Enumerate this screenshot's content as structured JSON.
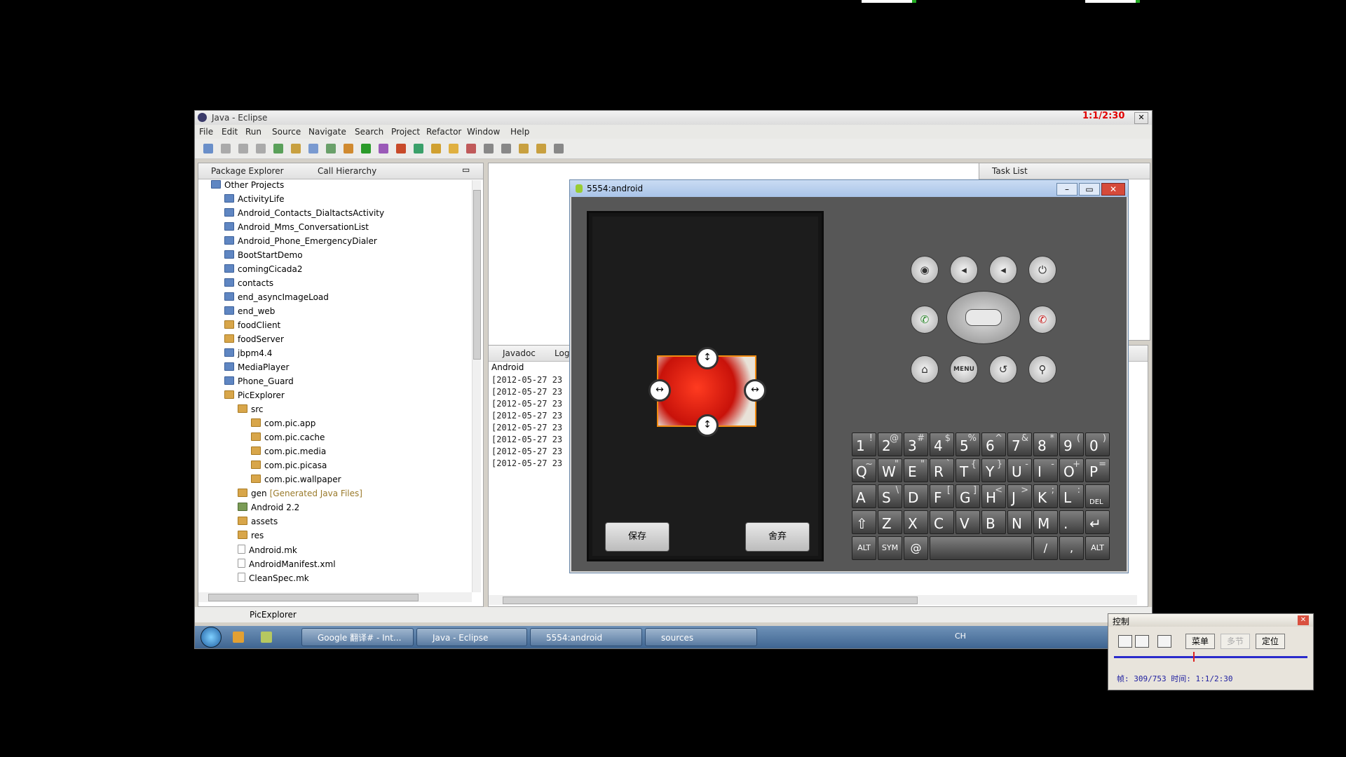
{
  "desktop": {
    "recording_overlay": "1:1/2:30"
  },
  "eclipse": {
    "title": "Java - Eclipse",
    "menu": [
      "File",
      "Edit",
      "Run",
      "Source",
      "Navigate",
      "Search",
      "Project",
      "Refactor",
      "Window",
      "Help"
    ],
    "views": {
      "package_explorer": "Package Explorer",
      "call_hierarchy": "Call Hierarchy",
      "task_list": "Task List",
      "javadoc": "Javadoc",
      "log": "Log"
    },
    "tree": [
      {
        "label": "Other Projects",
        "indent": 0,
        "icon": "folder"
      },
      {
        "label": "ActivityLife",
        "indent": 1,
        "icon": "folder"
      },
      {
        "label": "Android_Contacts_DialtactsActivity",
        "indent": 1,
        "icon": "folder"
      },
      {
        "label": "Android_Mms_ConversationList",
        "indent": 1,
        "icon": "folder"
      },
      {
        "label": "Android_Phone_EmergencyDialer",
        "indent": 1,
        "icon": "folder"
      },
      {
        "label": "BootStartDemo",
        "indent": 1,
        "icon": "folder"
      },
      {
        "label": "comingCicada2",
        "indent": 1,
        "icon": "folder"
      },
      {
        "label": "contacts",
        "indent": 1,
        "icon": "folder"
      },
      {
        "label": "end_asyncImageLoad",
        "indent": 1,
        "icon": "folder"
      },
      {
        "label": "end_web",
        "indent": 1,
        "icon": "folder"
      },
      {
        "label": "foodClient",
        "indent": 1,
        "icon": "pkg"
      },
      {
        "label": "foodServer",
        "indent": 1,
        "icon": "pkg"
      },
      {
        "label": "jbpm4.4",
        "indent": 1,
        "icon": "folder"
      },
      {
        "label": "MediaPlayer",
        "indent": 1,
        "icon": "folder"
      },
      {
        "label": "Phone_Guard",
        "indent": 1,
        "icon": "folder"
      },
      {
        "label": "PicExplorer",
        "indent": 1,
        "icon": "pkg"
      },
      {
        "label": "src",
        "indent": 2,
        "icon": "pkg"
      },
      {
        "label": "com.pic.app",
        "indent": 3,
        "icon": "pkg"
      },
      {
        "label": "com.pic.cache",
        "indent": 3,
        "icon": "pkg"
      },
      {
        "label": "com.pic.media",
        "indent": 3,
        "icon": "pkg"
      },
      {
        "label": "com.pic.picasa",
        "indent": 3,
        "icon": "pkg"
      },
      {
        "label": "com.pic.wallpaper",
        "indent": 3,
        "icon": "pkg"
      },
      {
        "label": "gen",
        "suffix": "[Generated Java Files]",
        "indent": 2,
        "icon": "pkg"
      },
      {
        "label": "Android 2.2",
        "indent": 2,
        "icon": "lib"
      },
      {
        "label": "assets",
        "indent": 2,
        "icon": "pkg"
      },
      {
        "label": "res",
        "indent": 2,
        "icon": "pkg"
      },
      {
        "label": "Android.mk",
        "indent": 2,
        "icon": "file"
      },
      {
        "label": "AndroidManifest.xml",
        "indent": 2,
        "icon": "file"
      },
      {
        "label": "CleanSpec.mk",
        "indent": 2,
        "icon": "file"
      }
    ],
    "console": {
      "header": "Android",
      "lines": [
        "[2012-05-27 23",
        "[2012-05-27 23",
        "[2012-05-27 23",
        "[2012-05-27 23",
        "[2012-05-27 23",
        "[2012-05-27 23",
        "[2012-05-27 23",
        "[2012-05-27 23"
      ]
    },
    "status": "PicExplorer"
  },
  "taskbar": {
    "buttons": [
      "Google 翻译# - Int...",
      "Java - Eclipse",
      "5554:android",
      "sources"
    ],
    "tray_lang": "CH"
  },
  "emulator": {
    "title": "5554:android",
    "save_label": "保存",
    "discard_label": "舍弃",
    "menu_label": "MENU",
    "keyboard": [
      [
        {
          "m": "1",
          "a": "!"
        },
        {
          "m": "2",
          "a": "@"
        },
        {
          "m": "3",
          "a": "#"
        },
        {
          "m": "4",
          "a": "$"
        },
        {
          "m": "5",
          "a": "%"
        },
        {
          "m": "6",
          "a": "^"
        },
        {
          "m": "7",
          "a": "&"
        },
        {
          "m": "8",
          "a": "*"
        },
        {
          "m": "9",
          "a": "("
        },
        {
          "m": "0",
          "a": ")"
        }
      ],
      [
        {
          "m": "Q",
          "a": "~"
        },
        {
          "m": "W",
          "a": "\""
        },
        {
          "m": "E",
          "a": "\""
        },
        {
          "m": "R",
          "a": "`"
        },
        {
          "m": "T",
          "a": "{"
        },
        {
          "m": "Y",
          "a": "}"
        },
        {
          "m": "U",
          "a": "-"
        },
        {
          "m": "I",
          "a": "-"
        },
        {
          "m": "O",
          "a": "+"
        },
        {
          "m": "P",
          "a": "="
        }
      ],
      [
        {
          "m": "A",
          "a": ""
        },
        {
          "m": "S",
          "a": "\\"
        },
        {
          "m": "D",
          "a": ""
        },
        {
          "m": "F",
          "a": "["
        },
        {
          "m": "G",
          "a": "]"
        },
        {
          "m": "H",
          "a": "<"
        },
        {
          "m": "J",
          "a": ">"
        },
        {
          "m": "K",
          "a": ";"
        },
        {
          "m": "L",
          "a": ":"
        },
        {
          "m": "DEL",
          "a": ""
        }
      ],
      [
        {
          "m": "⇧",
          "a": ""
        },
        {
          "m": "Z",
          "a": ""
        },
        {
          "m": "X",
          "a": ""
        },
        {
          "m": "C",
          "a": ""
        },
        {
          "m": "V",
          "a": ""
        },
        {
          "m": "B",
          "a": ""
        },
        {
          "m": "N",
          "a": ""
        },
        {
          "m": "M",
          "a": ""
        },
        {
          "m": ".",
          "a": ""
        },
        {
          "m": "↵",
          "a": ""
        }
      ]
    ],
    "bottom_keys": {
      "alt": "ALT",
      "sym": "SYM",
      "at": "@",
      "slash": "/",
      "slash_alt": "?",
      "comma": ","
    }
  },
  "control": {
    "title": "控制",
    "menu_label": "菜单",
    "multi_label": "多节",
    "locate_label": "定位",
    "info": "帧: 309/753 时间: 1:1/2:30",
    "progress": 0.41
  }
}
